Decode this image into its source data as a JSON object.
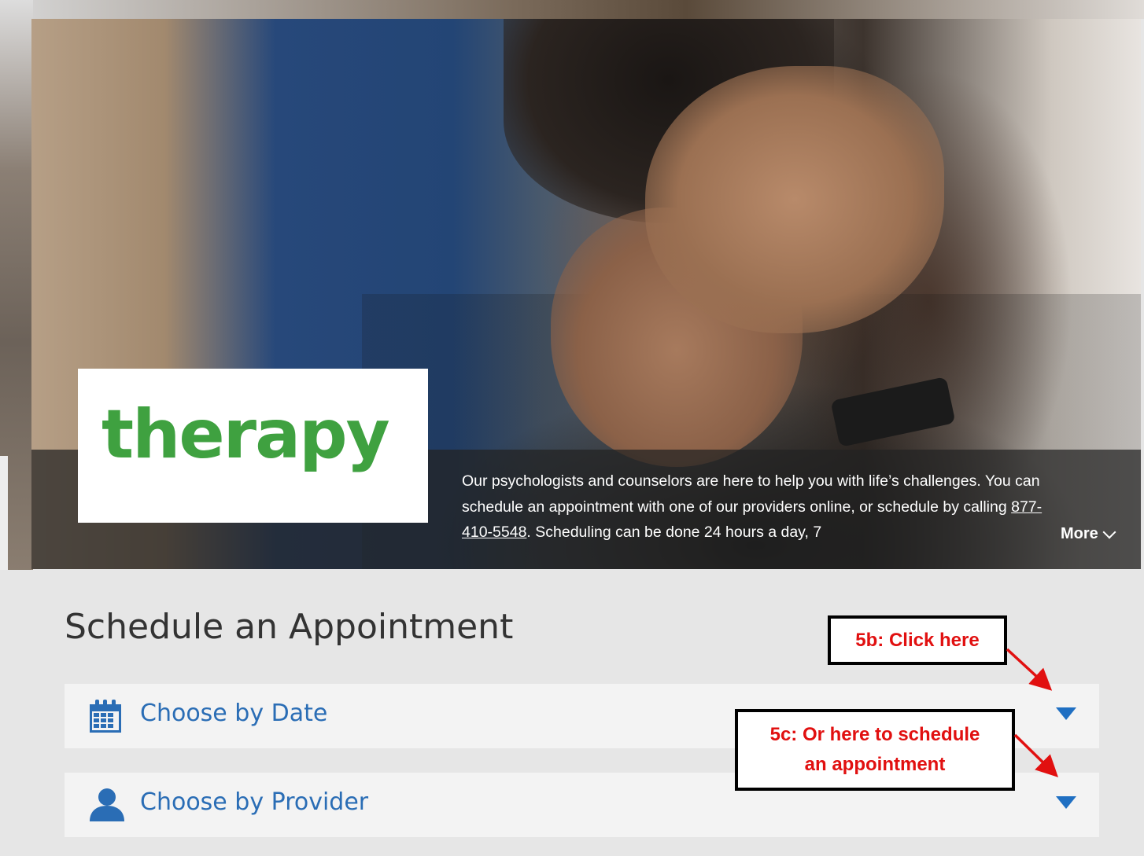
{
  "hero": {
    "logo_text": "therapy",
    "description_intro": "Our psychologists and counselors are here to help you with life’s challenges. You can schedule an appointment with one of our providers online, or schedule by calling ",
    "phone": "877-410-5548",
    "description_outro": ". Scheduling can be done 24 hours a day, 7",
    "more_label": "More"
  },
  "schedule": {
    "title": "Schedule an Appointment",
    "options": [
      {
        "label": "Choose by Date",
        "icon": "calendar-icon"
      },
      {
        "label": "Choose by Provider",
        "icon": "person-icon"
      }
    ]
  },
  "annotations": {
    "callout_b": "5b: Click here",
    "callout_c_line1": "5c: Or here to schedule",
    "callout_c_line2": "an appointment"
  },
  "colors": {
    "brand_green": "#3fa140",
    "link_blue": "#2a6db5",
    "arrow_blue": "#1f6fc2",
    "annotation_red": "#e11010"
  }
}
